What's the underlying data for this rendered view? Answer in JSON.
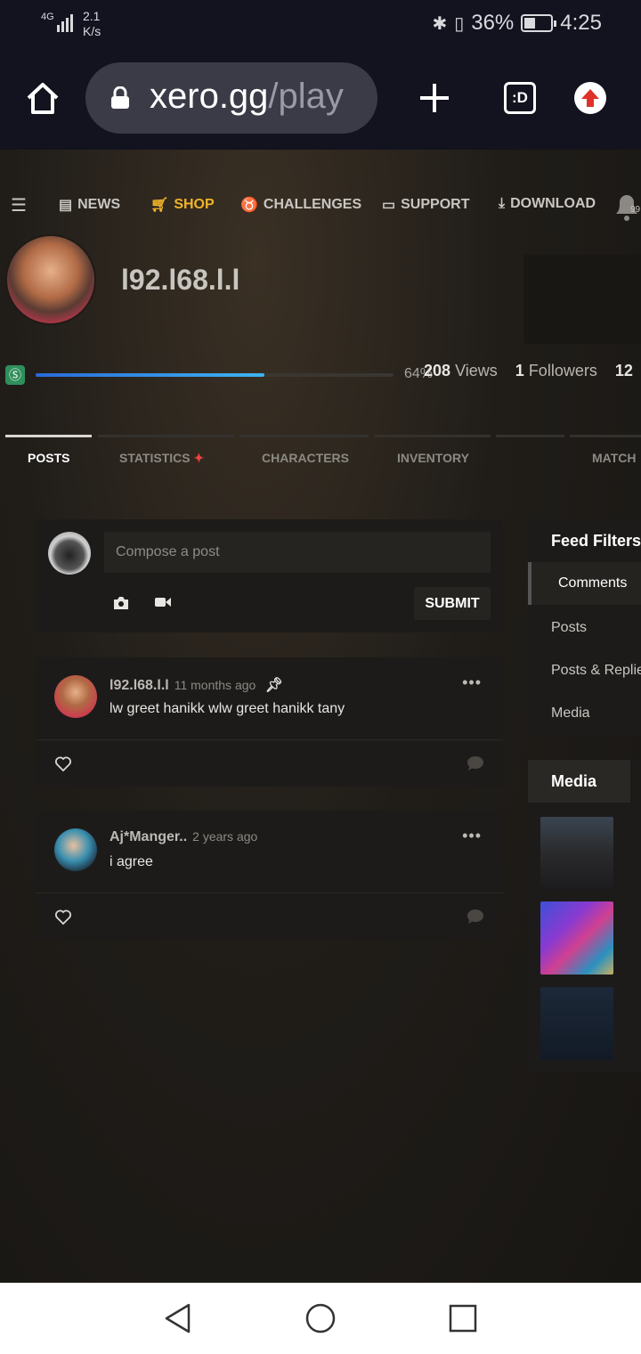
{
  "status": {
    "network": "4G",
    "speed_value": "2.1",
    "speed_unit": "K/s",
    "battery_pct": "36%",
    "time": "4:25"
  },
  "browser": {
    "url_host": "xero.gg",
    "url_path": "/play",
    "tab_badge": ":D"
  },
  "nav": {
    "items": [
      {
        "label": "NEWS",
        "icon": "newspaper-icon"
      },
      {
        "label": "SHOP",
        "icon": "cart-icon"
      },
      {
        "label": "CHALLENGES",
        "icon": "medal-icon"
      },
      {
        "label": "SUPPORT",
        "icon": "ticket-icon"
      },
      {
        "label": "DOWNLOAD",
        "icon": "download-icon"
      }
    ],
    "notif_count": "99"
  },
  "profile": {
    "username": "l92.l68.l.l",
    "xp_percent_label": "64%",
    "xp_fraction": 0.64,
    "views_count": "208",
    "views_label": "Views",
    "followers_count": "1",
    "followers_label": "Followers",
    "following_count": "12"
  },
  "tabs": [
    "POSTS",
    "STATISTICS",
    "CHARACTERS",
    "INVENTORY",
    "MATCH"
  ],
  "composer": {
    "placeholder": "Compose a post",
    "submit_label": "SUBMIT"
  },
  "posts": [
    {
      "author": "l92.l68.l.l",
      "time": "11 months ago",
      "text": "lw greet hanikk wlw greet hanikk tany",
      "pinned": true
    },
    {
      "author": "Aj*Manger..",
      "time": "2 years ago",
      "text": "i agree",
      "pinned": false
    }
  ],
  "feed_filters": {
    "title": "Feed Filters",
    "options": [
      "Comments",
      "Posts",
      "Posts & Replie",
      "Media"
    ],
    "selected": "Comments"
  },
  "media": {
    "title": "Media"
  },
  "colors": {
    "accent_shop": "#f0b429",
    "xp_bar": "#3fb4f0",
    "statistics_sparkle": "#e8453c"
  }
}
